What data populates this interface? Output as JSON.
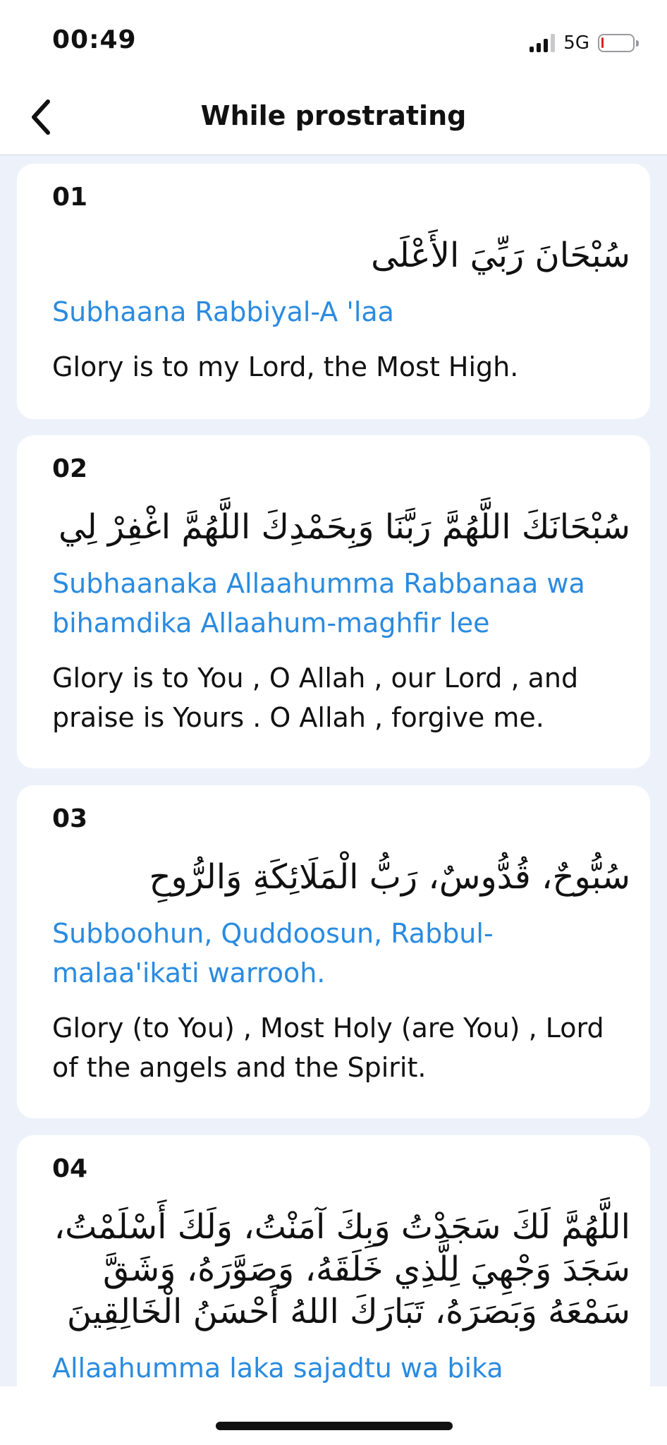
{
  "status": {
    "time": "00:49",
    "network": "5G",
    "battery_level": 0.05
  },
  "nav": {
    "title": "While prostrating",
    "back_icon": "chevron-left-icon"
  },
  "cards": [
    {
      "number": "01",
      "arabic": "سُبْحَانَ رَبِّيَ الأَعْلَى",
      "transliteration": "Subhaana Rabbiyal-A 'laa",
      "translation": "Glory is to my Lord, the Most High."
    },
    {
      "number": "02",
      "arabic": "سُبْحَانَكَ اللَّهُمَّ رَبَّنَا وَبِحَمْدِكَ اللَّهُمَّ اغْفِرْ لِي",
      "transliteration": "Subhaanaka Allaahumma Rabbanaa wa bihamdika Allaahum-maghfir lee",
      "translation": "Glory is to You , O Allah , our Lord , and praise is Yours . O Allah , forgive me."
    },
    {
      "number": "03",
      "arabic": "سُبُّوحٌ، قُدُّوسٌ، رَبُّ الْمَلَائِكَةِ وَالرُّوحِ",
      "transliteration": "Subboohun, Quddoosun, Rabbul-malaa'ikati warrooh.",
      "translation": "Glory (to You) , Most Holy (are You) , Lord of the angels and the Spirit."
    },
    {
      "number": "04",
      "arabic": "اللَّهُمَّ لَكَ سَجَدْتُ وَبِكَ آمَنْتُ، وَلَكَ أَسْلَمْتُ، سَجَدَ وَجْهِيَ لِلَّذِي خَلَقَهُ، وَصَوَّرَهُ، وَشَقَّ سَمْعَهُ وَبَصَرَهُ، تَبَارَكَ اللهُ أَحْسَنُ الْخَالِقِينَ",
      "transliteration": "Allaahumma laka sajadtu wa bika 'aamantu"
    }
  ]
}
